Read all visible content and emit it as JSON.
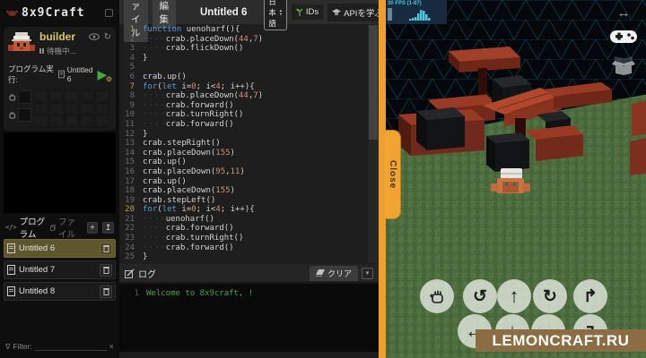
{
  "app": {
    "logo": "8x9Craft"
  },
  "menubar": {
    "file": "ファイル",
    "edit": "編集",
    "title": "Untitled 6",
    "language": "日本語",
    "ids_label": "IDs",
    "api_label": "APIを学ぶ"
  },
  "robot": {
    "name": "builder",
    "status": "待機中...",
    "run_label": "プログラム実行:",
    "run_target": "Untitled 6"
  },
  "panel_tabs": {
    "program": "プログラム",
    "files": "ファイル",
    "add": "+",
    "upload": "↥"
  },
  "file_list": [
    {
      "name": "Untitled 6",
      "selected": true
    },
    {
      "name": "Untitled 7",
      "selected": false
    },
    {
      "name": "Untitled 8",
      "selected": false
    }
  ],
  "filter": {
    "label": "Filter:",
    "clear": "×"
  },
  "editor": {
    "lines": [
      "function uenoharf(){",
      "    crab.placeDown(44,7)",
      "    crab.flickDown()",
      "}",
      "",
      "crab.up()",
      "for(let i=0; i<4; i++){",
      "    crab.placeDown(44,7)",
      "    crab.forward()",
      "    crab.turnRight()",
      "    crab.forward()",
      "}",
      "crab.stepRight()",
      "crab.placeDown(155)",
      "crab.up()",
      "crab.placeDown(95,11)",
      "crab.up()",
      "crab.placeDown(155)",
      "crab.stepLeft()",
      "for(let i=0; i<4; i++){",
      "    uenoharf()",
      "    crab.forward()",
      "    crab.turnRight()",
      "    crab.forward()",
      "}"
    ]
  },
  "log": {
    "title": "ログ",
    "clear_label": "クリア",
    "entries": [
      {
        "line": 1,
        "text": "Welcome to 8x9craft, !"
      }
    ]
  },
  "game": {
    "fps": "30 FPS (1-87)",
    "close_label": "Close",
    "watermark": "LEMONCRAFT.RU",
    "controls": {
      "rotate_left": "↺",
      "forward": "↑",
      "rotate_right": "↻",
      "jump_forward": "↱",
      "left": "←",
      "back": "↓",
      "right": "→",
      "jump_back": "↴"
    },
    "colors": {
      "accent_orange": "#ef9f2e",
      "grass_green": "#4d6c3d",
      "block_red": "#9a3a25",
      "wire_teal": "#0d4552",
      "log_green": "#4da44d"
    }
  }
}
